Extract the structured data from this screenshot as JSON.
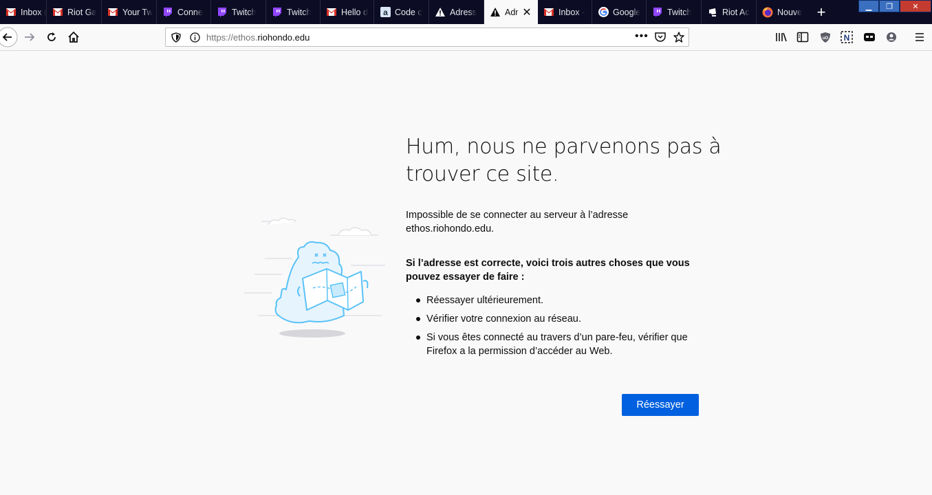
{
  "tabs": [
    {
      "label": "Inbox (",
      "icon": "gmail-icon"
    },
    {
      "label": "Riot Ga",
      "icon": "gmail-icon"
    },
    {
      "label": "Your Tw",
      "icon": "gmail-icon"
    },
    {
      "label": "Conne",
      "icon": "twitch-icon"
    },
    {
      "label": "Twitch",
      "icon": "twitch-icon"
    },
    {
      "label": "Twitch",
      "icon": "twitch-icon"
    },
    {
      "label": "Hello d",
      "icon": "gmail-icon"
    },
    {
      "label": "Code c",
      "icon": "amazon-icon"
    },
    {
      "label": "Adress",
      "icon": "warning-icon"
    },
    {
      "label": "Adr",
      "icon": "warning-icon",
      "active": true
    },
    {
      "label": "Inbox -",
      "icon": "gmail-icon"
    },
    {
      "label": "Google",
      "icon": "google-icon"
    },
    {
      "label": "Twitch",
      "icon": "twitch-icon"
    },
    {
      "label": "Riot Ac",
      "icon": "riot-icon"
    },
    {
      "label": "Nouve",
      "icon": "firefox-icon"
    }
  ],
  "url": {
    "prefix": "https://ethos.",
    "domain": "riohondo.edu"
  },
  "error": {
    "title": "Hum, nous ne parvenons pas à trouver ce site.",
    "description": "Impossible de se connecter au serveur à l’adresse ethos.riohondo.edu.",
    "tips_title": "Si l’adresse est correcte, voici trois autres choses que vous pouvez essayer de faire :",
    "tips": [
      "Réessayer ultérieurement.",
      "Vérifier votre connexion au réseau.",
      "Si vous êtes connecté au travers d’un pare-feu, vérifier que Firefox a la permission d’accéder au Web."
    ],
    "retry_label": "Réessayer"
  },
  "colors": {
    "accent": "#0060df",
    "tabbar": "#0c0c24",
    "page_bg": "#f9f9fa",
    "illustration": "#59c2f7"
  }
}
